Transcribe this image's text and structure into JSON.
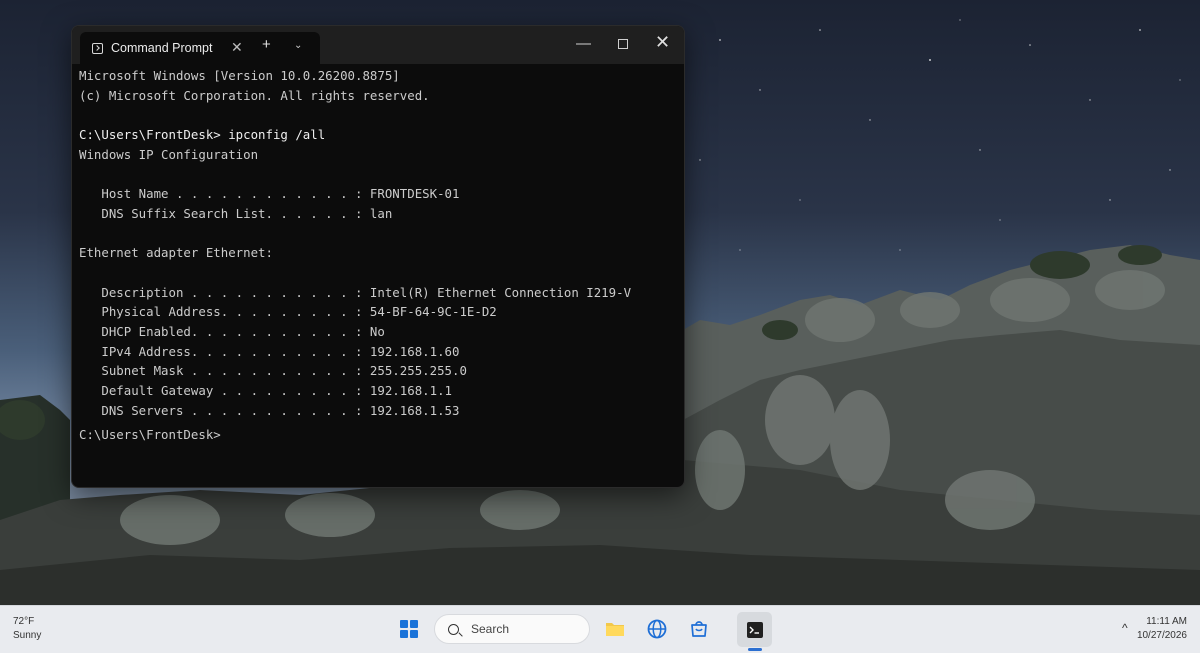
{
  "window": {
    "tab_title": "Command Prompt",
    "tab_close_glyph": "✕",
    "new_tab_glyph": "+",
    "dropdown_glyph": "⌄",
    "minimize_glyph": "—",
    "close_glyph": "✕"
  },
  "console": {
    "lines": [
      "Microsoft Windows [Version 10.0.26200.8875]",
      "(c) Microsoft Corporation. All rights reserved.",
      "",
      "C:\\Users\\FrontDesk> ipconfig /all",
      "Windows IP Configuration",
      "",
      "   Host Name . . . . . . . . . . . . : FRONTDESK-01",
      "   DNS Suffix Search List. . . . . . : lan",
      "",
      "Ethernet adapter Ethernet:",
      "",
      "   Description . . . . . . . . . . . : Intel(R) Ethernet Connection I219-V",
      "   Physical Address. . . . . . . . . : 54-BF-64-9C-1E-D2",
      "   DHCP Enabled. . . . . . . . . . . : No",
      "   IPv4 Address. . . . . . . . . . . : 192.168.1.60",
      "   Subnet Mask . . . . . . . . . . . : 255.255.255.0",
      "   Default Gateway . . . . . . . . . : 192.168.1.1",
      "   DNS Servers . . . . . . . . . . . : 192.168.1.53",
      "C:\\Users\\FrontDesk>"
    ]
  },
  "taskbar": {
    "weather_temp": "72°F",
    "weather_desc": "Sunny",
    "search_placeholder": "Search",
    "tray_chevron": "^",
    "time": "11:11 AM",
    "date": "10/27/2026",
    "accent": "#2b6fd1",
    "icons": [
      "windows-start-icon",
      "search-icon",
      "file-explorer-icon",
      "edge-browser-icon",
      "microsoft-store-icon",
      "terminal-icon"
    ]
  }
}
